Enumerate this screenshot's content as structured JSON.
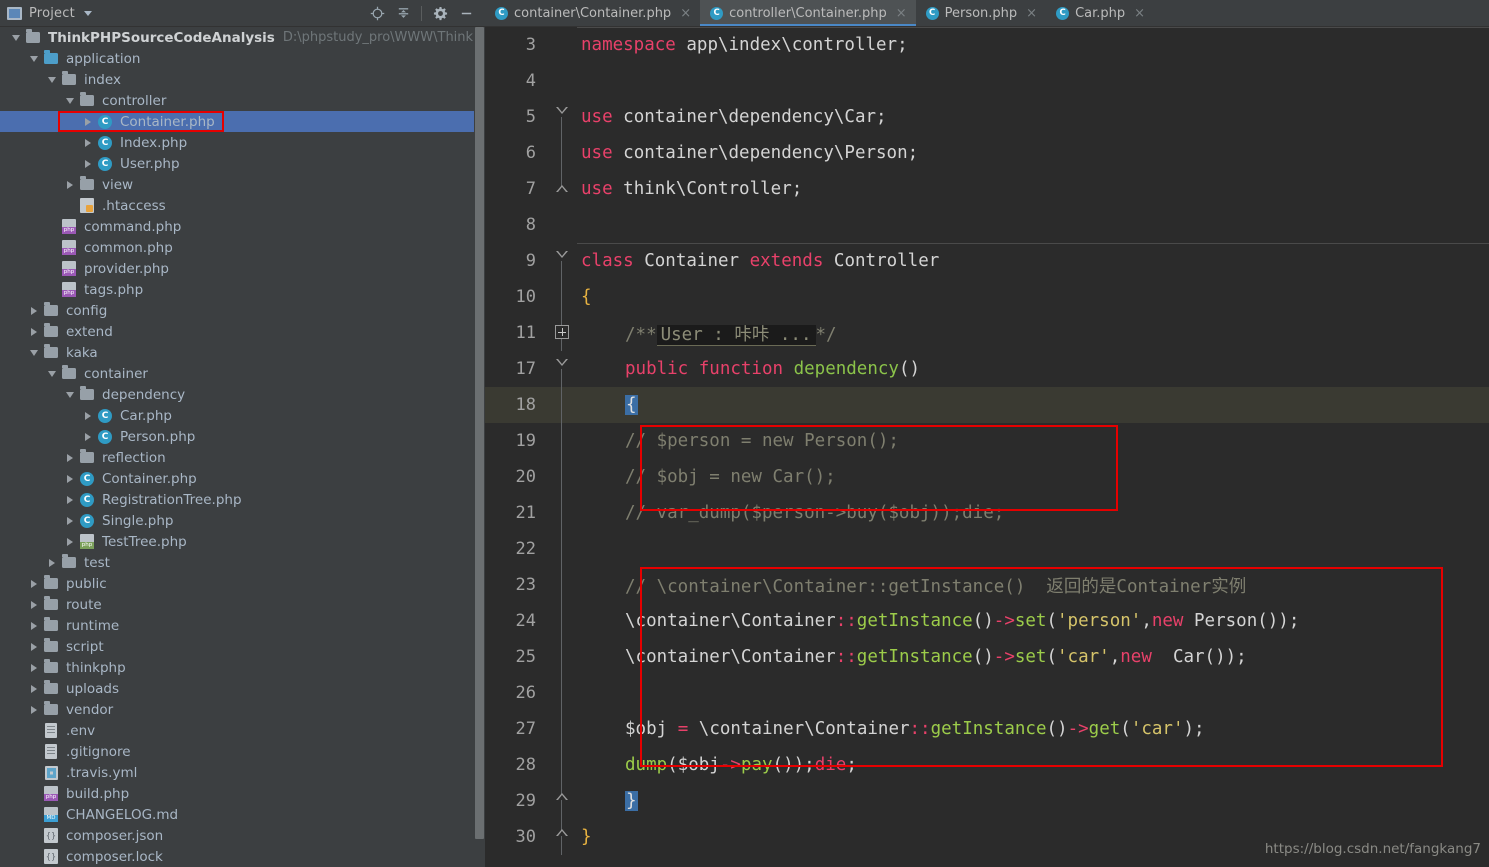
{
  "sidebar": {
    "panel_title": "Project",
    "icons": {
      "project": "project-window-icon",
      "locate": "locate-target-icon",
      "collapse": "collapse-all-icon",
      "settings": "gear-icon",
      "minimize": "minimize-icon"
    },
    "tree": [
      {
        "depth": 0,
        "tw": "down",
        "icon": "folder",
        "label": "ThinkPHPSourceCodeAnalysis",
        "bold": true,
        "path": "D:\\phpstudy_pro\\WWW\\ThinkPHPSourceCo"
      },
      {
        "depth": 1,
        "tw": "down",
        "icon": "folder-blue",
        "label": "application"
      },
      {
        "depth": 2,
        "tw": "down",
        "icon": "folder",
        "label": "index"
      },
      {
        "depth": 3,
        "tw": "down",
        "icon": "folder",
        "label": "controller"
      },
      {
        "depth": 4,
        "tw": "right",
        "icon": "class",
        "label": "Container.php",
        "selected": true
      },
      {
        "depth": 4,
        "tw": "right",
        "icon": "class",
        "label": "Index.php"
      },
      {
        "depth": 4,
        "tw": "right",
        "icon": "class",
        "label": "User.php"
      },
      {
        "depth": 3,
        "tw": "right",
        "icon": "folder",
        "label": "view"
      },
      {
        "depth": 3,
        "tw": "none",
        "icon": "htaccess",
        "label": ".htaccess"
      },
      {
        "depth": 2,
        "tw": "none",
        "icon": "php",
        "label": "command.php"
      },
      {
        "depth": 2,
        "tw": "none",
        "icon": "php",
        "label": "common.php"
      },
      {
        "depth": 2,
        "tw": "none",
        "icon": "php",
        "label": "provider.php"
      },
      {
        "depth": 2,
        "tw": "none",
        "icon": "php",
        "label": "tags.php"
      },
      {
        "depth": 1,
        "tw": "right",
        "icon": "folder",
        "label": "config"
      },
      {
        "depth": 1,
        "tw": "right",
        "icon": "folder",
        "label": "extend"
      },
      {
        "depth": 1,
        "tw": "down",
        "icon": "folder",
        "label": "kaka"
      },
      {
        "depth": 2,
        "tw": "down",
        "icon": "folder",
        "label": "container"
      },
      {
        "depth": 3,
        "tw": "down",
        "icon": "folder",
        "label": "dependency"
      },
      {
        "depth": 4,
        "tw": "right",
        "icon": "class",
        "label": "Car.php"
      },
      {
        "depth": 4,
        "tw": "right",
        "icon": "class",
        "label": "Person.php"
      },
      {
        "depth": 3,
        "tw": "right",
        "icon": "folder",
        "label": "reflection"
      },
      {
        "depth": 3,
        "tw": "right",
        "icon": "class",
        "label": "Container.php"
      },
      {
        "depth": 3,
        "tw": "right",
        "icon": "class",
        "label": "RegistrationTree.php"
      },
      {
        "depth": 3,
        "tw": "right",
        "icon": "class",
        "label": "Single.php"
      },
      {
        "depth": 3,
        "tw": "right",
        "icon": "php-tree",
        "label": "TestTree.php"
      },
      {
        "depth": 2,
        "tw": "right",
        "icon": "folder",
        "label": "test"
      },
      {
        "depth": 1,
        "tw": "right",
        "icon": "folder",
        "label": "public"
      },
      {
        "depth": 1,
        "tw": "right",
        "icon": "folder",
        "label": "route"
      },
      {
        "depth": 1,
        "tw": "right",
        "icon": "folder",
        "label": "runtime"
      },
      {
        "depth": 1,
        "tw": "right",
        "icon": "folder",
        "label": "script"
      },
      {
        "depth": 1,
        "tw": "right",
        "icon": "folder",
        "label": "thinkphp"
      },
      {
        "depth": 1,
        "tw": "right",
        "icon": "folder",
        "label": "uploads"
      },
      {
        "depth": 1,
        "tw": "right",
        "icon": "folder",
        "label": "vendor"
      },
      {
        "depth": 1,
        "tw": "none",
        "icon": "text",
        "label": ".env"
      },
      {
        "depth": 1,
        "tw": "none",
        "icon": "text",
        "label": ".gitignore"
      },
      {
        "depth": 1,
        "tw": "none",
        "icon": "yml",
        "label": ".travis.yml"
      },
      {
        "depth": 1,
        "tw": "none",
        "icon": "php",
        "label": "build.php"
      },
      {
        "depth": 1,
        "tw": "none",
        "icon": "md",
        "label": "CHANGELOG.md"
      },
      {
        "depth": 1,
        "tw": "none",
        "icon": "json",
        "label": "composer.json"
      },
      {
        "depth": 1,
        "tw": "none",
        "icon": "json",
        "label": "composer.lock"
      }
    ]
  },
  "tabs": [
    {
      "label": "container\\Container.php",
      "active": false,
      "close": "×"
    },
    {
      "label": "controller\\Container.php",
      "active": true,
      "close": "×"
    },
    {
      "label": "Person.php",
      "active": false,
      "close": "×"
    },
    {
      "label": "Car.php",
      "active": false,
      "close": "×"
    }
  ],
  "editor": {
    "lines": [
      {
        "no": "3",
        "fold": "none"
      },
      {
        "no": "4",
        "fold": "none"
      },
      {
        "no": "5",
        "fold": "tri-down"
      },
      {
        "no": "6",
        "fold": "line"
      },
      {
        "no": "7",
        "fold": "tri-up"
      },
      {
        "no": "8",
        "fold": "none"
      },
      {
        "no": "9",
        "fold": "tri-down"
      },
      {
        "no": "10",
        "fold": "line"
      },
      {
        "no": "11",
        "fold": "plus"
      },
      {
        "no": "17",
        "fold": "tri-down"
      },
      {
        "no": "18",
        "fold": "line",
        "highlight": true
      },
      {
        "no": "19",
        "fold": "line"
      },
      {
        "no": "20",
        "fold": "line"
      },
      {
        "no": "21",
        "fold": "line"
      },
      {
        "no": "22",
        "fold": "line"
      },
      {
        "no": "23",
        "fold": "line"
      },
      {
        "no": "24",
        "fold": "line"
      },
      {
        "no": "25",
        "fold": "line"
      },
      {
        "no": "26",
        "fold": "line"
      },
      {
        "no": "27",
        "fold": "line"
      },
      {
        "no": "28",
        "fold": "line"
      },
      {
        "no": "29",
        "fold": "tri-up"
      },
      {
        "no": "30",
        "fold": "tri-up"
      }
    ],
    "code_text": {
      "l3": "namespace app\\index\\controller;",
      "l5": "use container\\dependency\\Car;",
      "l6": "use container\\dependency\\Person;",
      "l7": "use think\\Controller;",
      "l9": "class Container extends Controller",
      "l10": "{",
      "l11_pre": "/**",
      "l11_fold": "User : 咔咔 ...",
      "l11_post": "*/",
      "l17": "public function dependency()",
      "l18": "{",
      "l19": "// $person = new Person();",
      "l20": "// $obj = new Car();",
      "l21": "// var_dump($person->buy($obj));die;",
      "l23": "// \\container\\Container::getInstance()  返回的是Container实例",
      "l24": "\\container\\Container::getInstance()->set('person',new Person());",
      "l25": "\\container\\Container::getInstance()->set('car',new  Car());",
      "l27": "$obj = \\container\\Container::getInstance()->get('car');",
      "l28": "dump($obj->pay());die;",
      "l29": "}",
      "l30": "}"
    },
    "watermark": "https://blog.csdn.net/fangkang7"
  },
  "colors": {
    "keyword": "#e8416a",
    "function": "#8bc34a",
    "string": "#d6c46a",
    "comment": "#7f7f6f",
    "plain": "#d4d4d4",
    "annotation_box": "#e60000",
    "selection": "#4b6eaf",
    "editor_bg": "#2b2b2b",
    "panel_bg": "#3c3f41"
  }
}
